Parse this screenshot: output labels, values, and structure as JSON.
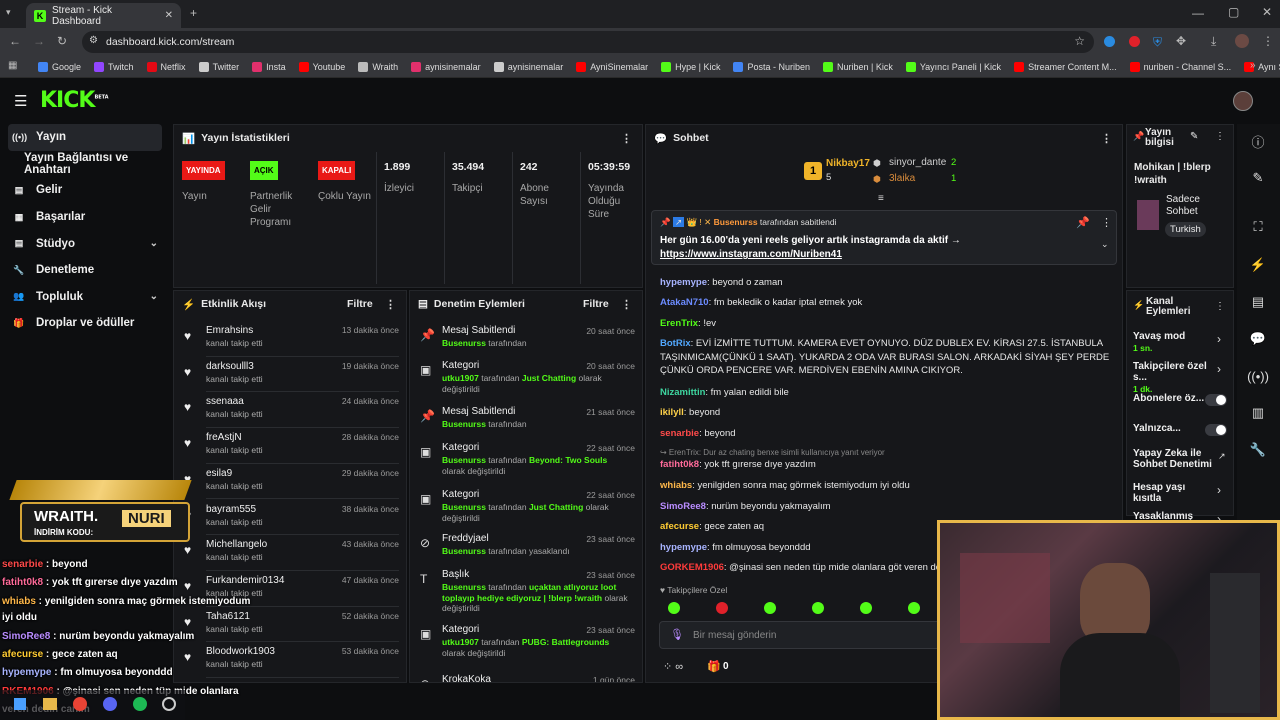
{
  "browser": {
    "tab_title": "Stream - Kick Dashboard",
    "url": "dashboard.kick.com/stream"
  },
  "bookmarks": [
    {
      "label": "Google",
      "color": "#4285f4"
    },
    {
      "label": "Twitch",
      "color": "#9146ff"
    },
    {
      "label": "Netflix",
      "color": "#e50914"
    },
    {
      "label": "Twitter",
      "color": "#cccccc"
    },
    {
      "label": "Insta",
      "color": "#e1306c"
    },
    {
      "label": "Youtube",
      "color": "#ff0000"
    },
    {
      "label": "Wraith",
      "color": "#bbbbbb"
    },
    {
      "label": "aynisinemalar",
      "color": "#e1306c"
    },
    {
      "label": "aynisinemalar",
      "color": "#cccccc"
    },
    {
      "label": "AyniSinemalar",
      "color": "#ff0000"
    },
    {
      "label": "Hype | Kick",
      "color": "#53fc18"
    },
    {
      "label": "Posta - Nuriben",
      "color": "#4285f4"
    },
    {
      "label": "Nuriben | Kick",
      "color": "#53fc18"
    },
    {
      "label": "Yayıncı Paneli | Kick",
      "color": "#53fc18"
    },
    {
      "label": "Streamer Content M...",
      "color": "#ff0000"
    },
    {
      "label": "nuriben - Channel S...",
      "color": "#ff0000"
    },
    {
      "label": "Aynı Sinemalar - Ça...",
      "color": "#ff0000"
    }
  ],
  "nav": {
    "items": [
      {
        "label": "Yayın",
        "icon": "broadcast-icon",
        "active": true
      },
      {
        "label": "Yayın Bağlantısı ve Anahtarı",
        "icon": "",
        "active": false
      },
      {
        "label": "Gelir",
        "icon": "revenue-icon"
      },
      {
        "label": "Başarılar",
        "icon": "achievements-icon"
      },
      {
        "label": "Stüdyo",
        "icon": "studio-icon",
        "chevron": true
      },
      {
        "label": "Denetleme",
        "icon": "wrench-icon"
      },
      {
        "label": "Topluluk",
        "icon": "community-icon",
        "chevron": true
      },
      {
        "label": "Droplar ve ödüller",
        "icon": "gift-icon"
      }
    ]
  },
  "stats": {
    "title": "Yayın İstatistikleri",
    "badges": [
      {
        "label": "YAYINDA",
        "color": "#e91916",
        "caption": "Yayın"
      },
      {
        "label": "AÇIK",
        "color": "#53fc18",
        "caption": "Partnerlik Gelir Programı"
      },
      {
        "label": "KAPALI",
        "color": "#e91916",
        "caption": "Çoklu Yayın"
      }
    ],
    "values": [
      {
        "value": "1.899",
        "caption": "İzleyici"
      },
      {
        "value": "35.494",
        "caption": "Takipçi"
      },
      {
        "value": "242",
        "caption": "Abone Sayısı"
      },
      {
        "value": "05:39:59",
        "caption": "Yayında Olduğu Süre"
      }
    ]
  },
  "events": {
    "title": "Etkinlik Akışı",
    "filter": "Filtre",
    "sub": "kanalı takip etti",
    "items": [
      {
        "name": "Emrahsins",
        "time": "13 dakika önce"
      },
      {
        "name": "darksoulll3",
        "time": "19 dakika önce"
      },
      {
        "name": "ssenaaa",
        "time": "24 dakika önce"
      },
      {
        "name": "freAstjN",
        "time": "28 dakika önce"
      },
      {
        "name": "esila9",
        "time": "29 dakika önce"
      },
      {
        "name": "bayram555",
        "time": "38 dakika önce"
      },
      {
        "name": "Michellangelo",
        "time": "43 dakika önce"
      },
      {
        "name": "Furkandemir0134",
        "time": "47 dakika önce"
      },
      {
        "name": "Taha6121",
        "time": "52 dakika önce"
      },
      {
        "name": "Bloodwork1903",
        "time": "53 dakika önce"
      }
    ]
  },
  "mod": {
    "title": "Denetim Eylemleri",
    "filter": "Filtre",
    "items": [
      {
        "name": "Mesaj Sabitlendi",
        "time": "20 saat önce",
        "user": "Busenurss",
        "pre": "",
        "text": " tarafından",
        "hl": "",
        "post": "",
        "icon": "pin-icon"
      },
      {
        "name": "Kategori",
        "time": "20 saat önce",
        "user": "utku1907",
        "pre": "",
        "text": " tarafından ",
        "hl": "Just Chatting",
        "post": " olarak değiştirildi",
        "icon": "category-icon"
      },
      {
        "name": "Mesaj Sabitlendi",
        "time": "21 saat önce",
        "user": "Busenurss",
        "pre": "",
        "text": " tarafından",
        "hl": "",
        "post": "",
        "icon": "pin-icon"
      },
      {
        "name": "Kategori",
        "time": "22 saat önce",
        "user": "Busenurss",
        "pre": "",
        "text": " tarafından ",
        "hl": "Beyond: Two Souls",
        "post": " olarak değiştirildi",
        "icon": "category-icon"
      },
      {
        "name": "Kategori",
        "time": "22 saat önce",
        "user": "Busenurss",
        "pre": "",
        "text": " tarafından ",
        "hl": "Just Chatting",
        "post": " olarak değiştirildi",
        "icon": "category-icon"
      },
      {
        "name": "Freddyjael",
        "time": "23 saat önce",
        "user": "Busenurss",
        "pre": "",
        "text": " tarafından yasaklandı",
        "hl": "",
        "post": "",
        "icon": "ban-icon"
      },
      {
        "name": "Başlık",
        "time": "23 saat önce",
        "user": "Busenurss",
        "pre": "",
        "text": " tarafından ",
        "hl": "uçaktan atlıyoruz loot toplayıp hediye ediyoruz | !blerp !wraith",
        "post": " olarak değiştirildi",
        "icon": "title-icon"
      },
      {
        "name": "Kategori",
        "time": "23 saat önce",
        "user": "utku1907",
        "pre": "",
        "text": " tarafından ",
        "hl": "PUBG: Battlegrounds",
        "post": " olarak değiştirildi",
        "icon": "category-icon"
      },
      {
        "name": "KrokaKoka",
        "time": "1 gün önce",
        "user": "",
        "pre": "",
        "text": "",
        "hl": "",
        "post": "",
        "icon": "ban-icon"
      }
    ]
  },
  "chat": {
    "title": "Sohbet",
    "top": [
      {
        "name": "Nikbay17",
        "count": "5"
      },
      {
        "name": "sinyor_dante",
        "count": "2"
      },
      {
        "name": "3laika",
        "count": "1"
      }
    ],
    "pinned": {
      "by": "Busenurss",
      "by_suffix": " tarafından sabitlendi",
      "text": "Her gün 16.00'da yeni reels geliyor artık instagramda da aktif →",
      "link": "https://www.instagram.com/Nuriben41"
    },
    "messages": [
      {
        "user": "hypemype",
        "color": "#a8b4ff",
        "text": "beyond o zaman"
      },
      {
        "user": "AtakaN710",
        "color": "#6c8cff",
        "text": "fm bekledik o kadar iptal etmek yok"
      },
      {
        "user": "ErenTrix",
        "color": "#53fc18",
        "text": "!ev"
      },
      {
        "user": "BotRix",
        "color": "#52a8ff",
        "text": "EVİ İZMİTTE TUTTUM. KAMERA EVET OYNUYO. DÜZ DUBLEX EV. KİRASI 27.5. İSTANBULA TAŞINMICAM(ÇÜNKÜ 1 SAAT). YUKARDA 2 ODA VAR BURASI SALON. ARKADAKİ SİYAH ŞEY PERDE ÇÜNKÜ ORDA PENCERE VAR. MERDİVEN EBENİN AMINA CIKIYOR."
      },
      {
        "user": "Nizamittin",
        "color": "#3ed6a0",
        "text": "fm yalan edildi bile"
      },
      {
        "user": "ikilyll",
        "color": "#ffd24a",
        "text": "beyond"
      },
      {
        "user": "senarbie",
        "color": "#ff4a4a",
        "text": "beyond"
      },
      {
        "user": "fatiht0k8",
        "color": "#ff6b9a",
        "text": "yok tft gırerse dıye yazdım",
        "reply": "ErenTrix: Dur az chating benxe isimli kullanıcıya yanıt veriyor"
      },
      {
        "user": "whiabs",
        "color": "#ffb84a",
        "text": "yenilgiden sonra maç görmek istemiyodum iyi oldu"
      },
      {
        "user": "SimoRee8",
        "color": "#b98cff",
        "text": "nurüm beyondu yakmayalım"
      },
      {
        "user": "afecurse",
        "color": "#ffcc33",
        "text": "gece zaten aq"
      },
      {
        "user": "hypemype",
        "color": "#a8b4ff",
        "text": "fm olmuyosa beyonddd"
      },
      {
        "user": "GORKEM1906",
        "color": "#ff3b3b",
        "text": "@şinasi sen neden tüp mide olanlara göt veren dedin canım"
      }
    ],
    "followers_only": "Takipçilere Özel",
    "placeholder": "Bir mesaj gönderin",
    "footer_count": "0"
  },
  "info": {
    "title": "Yayın bilgisi",
    "stream_title": "Mohikan | !blerp !wraith",
    "category": "Sadece Sohbet",
    "language": "Turkish"
  },
  "channel": {
    "title": "Kanal Eylemleri",
    "settings": [
      {
        "label": "Yavaş mod",
        "value": "1 sn."
      },
      {
        "label": "Takipçilere özel s...",
        "value": "1 dk."
      },
      {
        "label": "Abonelere öz...",
        "value": ""
      },
      {
        "label": "Yalnızca...",
        "value": ""
      },
      {
        "label": "Yapay Zeka ile Sohbet Denetimi",
        "value": ""
      },
      {
        "label": "Hesap yaşı kısıtla",
        "value": ""
      },
      {
        "label": "Yasaklanmış kelin...",
        "value": ""
      }
    ]
  },
  "overlay": {
    "sponsor_name": "WRAITH.",
    "sponsor_code_label": "İNDİRİM KODU:",
    "sponsor_code": "NURI",
    "chat": [
      {
        "user": "senarbie",
        "color": "#ff4a4a",
        "text": "beyond"
      },
      {
        "user": "fatiht0k8",
        "color": "#ff6b9a",
        "text": "yok tft gırerse dıye yazdım"
      },
      {
        "user": "whiabs",
        "color": "#ffb84a",
        "text": "yenilgiden sonra maç görmek istemiyodum"
      },
      {
        "user": "",
        "color": "#ffffff",
        "text": "iyi oldu"
      },
      {
        "user": "SimoRee8",
        "color": "#b98cff",
        "text": "nurüm beyondu yakmayalım"
      },
      {
        "user": "afecurse",
        "color": "#ffcc33",
        "text": "gece zaten aq"
      },
      {
        "user": "hypemype",
        "color": "#a8b4ff",
        "text": "fm olmuyosa beyonddd"
      },
      {
        "user": "RKEM1906",
        "color": "#ff3b3b",
        "text": "@şinasi sen neden tüp mide olanlara"
      },
      {
        "user": "",
        "color": "#ffffff",
        "text": "veren dedin canım"
      }
    ]
  }
}
